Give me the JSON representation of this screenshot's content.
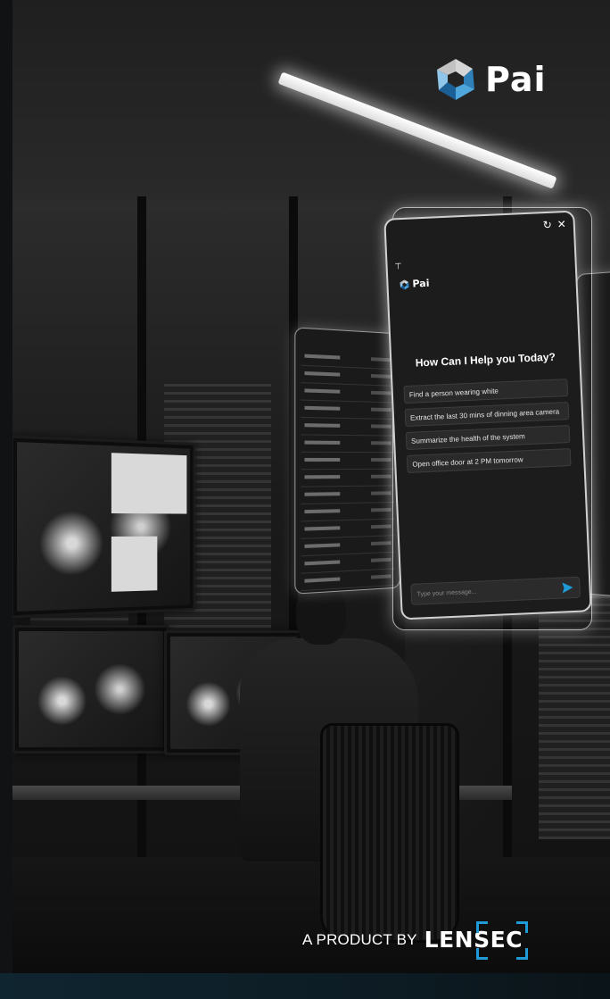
{
  "brand": {
    "name": "Pai"
  },
  "chat": {
    "heading": "How Can I Help you Today?",
    "suggestions": [
      "Find a person wearing white",
      "Extract the last 30 mins of dinning area camera",
      "Summarize the health of the system",
      "Open office door at 2 PM tomorrow"
    ],
    "input_placeholder": "Type your message...",
    "refresh_icon": "refresh-icon",
    "close_icon": "close-icon",
    "send_icon": "send-icon"
  },
  "footer": {
    "tagline": "A PRODUCT BY",
    "company": "LENSEC"
  },
  "colors": {
    "accent": "#1e9bd7",
    "send": "#1e9bd7",
    "chat_bg": "#1c1c1c"
  }
}
